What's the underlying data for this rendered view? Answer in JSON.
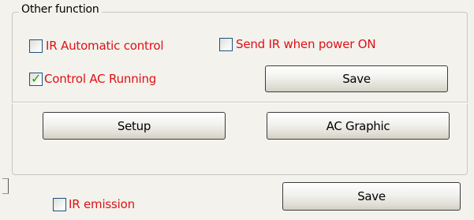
{
  "other_function": {
    "title": "Other function",
    "ir_automatic_control": {
      "label": "IR Automatic control",
      "checked": false
    },
    "send_ir_when_power_on": {
      "label": "Send IR when power ON",
      "checked": false
    },
    "control_ac_running": {
      "label": "Control AC Running",
      "checked": true
    },
    "save_label": "Save",
    "setup_label": "Setup",
    "ac_graphic_label": "AC Graphic"
  },
  "bottom": {
    "ir_emission": {
      "label": "IR emission",
      "checked": false
    },
    "save_label": "Save"
  },
  "colors": {
    "label_red": "#e01015",
    "check_green": "#22a11b",
    "checkbox_border": "#1d5180"
  }
}
